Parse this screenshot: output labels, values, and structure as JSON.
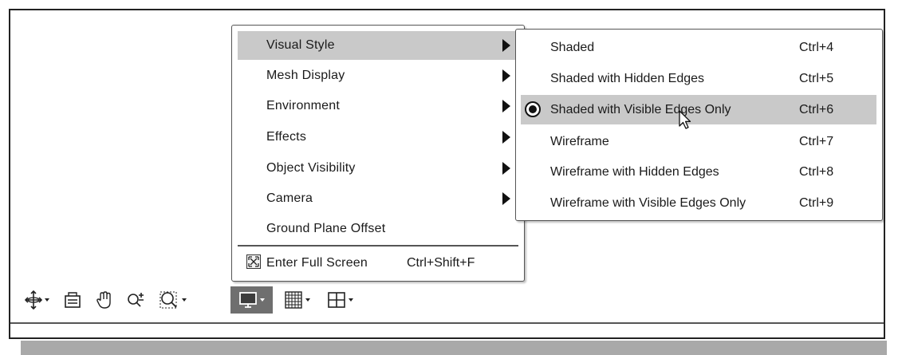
{
  "main_menu": {
    "items": [
      {
        "label": "Visual Style",
        "has_submenu": true,
        "highlighted": true
      },
      {
        "label": "Mesh Display",
        "has_submenu": true
      },
      {
        "label": "Environment",
        "has_submenu": true
      },
      {
        "label": "Effects",
        "has_submenu": true
      },
      {
        "label": "Object Visibility",
        "has_submenu": true
      },
      {
        "label": "Camera",
        "has_submenu": true
      },
      {
        "label": "Ground Plane Offset",
        "has_submenu": false
      }
    ],
    "full_screen": {
      "label": "Enter Full Screen",
      "shortcut": "Ctrl+Shift+F",
      "icon": "fullscreen-icon"
    }
  },
  "visual_style_submenu": {
    "items": [
      {
        "label": "Shaded",
        "shortcut": "Ctrl+4"
      },
      {
        "label": "Shaded with Hidden Edges",
        "shortcut": "Ctrl+5"
      },
      {
        "label": "Shaded with Visible Edges Only",
        "shortcut": "Ctrl+6",
        "selected": true,
        "highlighted": true
      },
      {
        "label": "Wireframe",
        "shortcut": "Ctrl+7"
      },
      {
        "label": "Wireframe with Hidden Edges",
        "shortcut": "Ctrl+8"
      },
      {
        "label": "Wireframe with Visible Edges Only",
        "shortcut": "Ctrl+9"
      }
    ]
  },
  "toolbar": {
    "buttons": [
      {
        "icon": "orbit-icon",
        "dropdown": true
      },
      {
        "icon": "look-at-icon",
        "dropdown": false
      },
      {
        "icon": "pan-hand-icon",
        "dropdown": false
      },
      {
        "icon": "zoom-icon",
        "dropdown": false
      },
      {
        "icon": "zoom-window-icon",
        "dropdown": true
      },
      {
        "icon": "display-settings-icon",
        "dropdown": true,
        "active": true
      },
      {
        "icon": "grid-icon",
        "dropdown": true
      },
      {
        "icon": "viewports-icon",
        "dropdown": true
      }
    ]
  },
  "colors": {
    "highlight": "#c9c9c9",
    "active_button": "#6f6f6f",
    "border": "#555555"
  }
}
